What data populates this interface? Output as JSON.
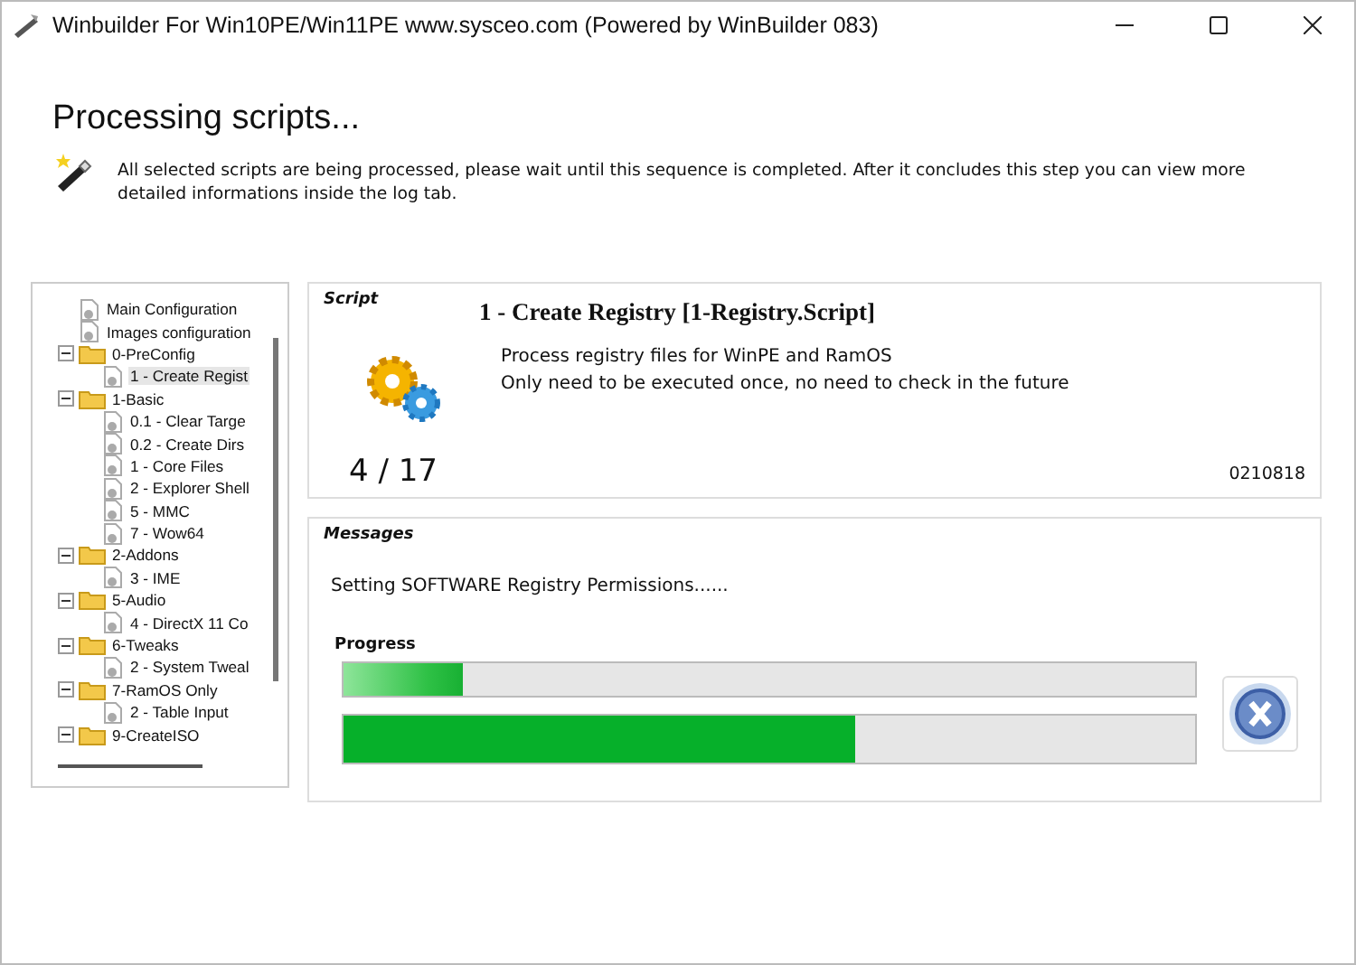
{
  "window": {
    "title": "Winbuilder For Win10PE/Win11PE  www.sysceo.com (Powered by WinBuilder 083)"
  },
  "header": {
    "title": "Processing scripts...",
    "description": "All selected scripts are being processed, please wait until this sequence is completed. After it concludes this step you can view more detailed informations inside the log tab."
  },
  "tree": [
    {
      "label": "Main Configuration",
      "kind": "script",
      "selected": false
    },
    {
      "label": "Images configuration",
      "kind": "script",
      "selected": false
    },
    {
      "label": "0-PreConfig",
      "kind": "folder",
      "selected": false,
      "expanded": true,
      "children": [
        {
          "label": "1 - Create Regist",
          "kind": "script",
          "selected": true
        }
      ]
    },
    {
      "label": "1-Basic",
      "kind": "folder",
      "selected": false,
      "expanded": true,
      "children": [
        {
          "label": "0.1 - Clear Targe",
          "kind": "script",
          "selected": false
        },
        {
          "label": "0.2 - Create Dirs",
          "kind": "script",
          "selected": false
        },
        {
          "label": "1 - Core Files",
          "kind": "script",
          "selected": false
        },
        {
          "label": "2 - Explorer Shell",
          "kind": "script",
          "selected": false
        },
        {
          "label": "5 - MMC",
          "kind": "script",
          "selected": false
        },
        {
          "label": "7 - Wow64",
          "kind": "script",
          "selected": false
        }
      ]
    },
    {
      "label": "2-Addons",
      "kind": "folder",
      "selected": false,
      "expanded": true,
      "children": [
        {
          "label": "3 - IME",
          "kind": "script",
          "selected": false
        }
      ]
    },
    {
      "label": "5-Audio",
      "kind": "folder",
      "selected": false,
      "expanded": true,
      "children": [
        {
          "label": "4 - DirectX 11 Co",
          "kind": "script",
          "selected": false
        }
      ]
    },
    {
      "label": "6-Tweaks",
      "kind": "folder",
      "selected": false,
      "expanded": true,
      "children": [
        {
          "label": "2 - System Tweal",
          "kind": "script",
          "selected": false
        }
      ]
    },
    {
      "label": "7-RamOS Only",
      "kind": "folder",
      "selected": false,
      "expanded": true,
      "children": [
        {
          "label": "2 - Table Input",
          "kind": "script",
          "selected": false
        }
      ]
    },
    {
      "label": "9-CreateISO",
      "kind": "folder",
      "selected": false,
      "expanded": true
    }
  ],
  "script": {
    "heading": "Script",
    "title": "1 - Create Registry [1-Registry.Script]",
    "description": [
      "Process registry files for WinPE and RamOS",
      "Only need to be executed once, no need to check in the future"
    ],
    "counter": "4 / 17",
    "version": "0210818"
  },
  "messages": {
    "heading": "Messages",
    "text": "Setting SOFTWARE Registry Permissions......",
    "progress_label": "Progress",
    "bars": [
      {
        "level": 0.14
      },
      {
        "level": 0.6
      }
    ]
  }
}
